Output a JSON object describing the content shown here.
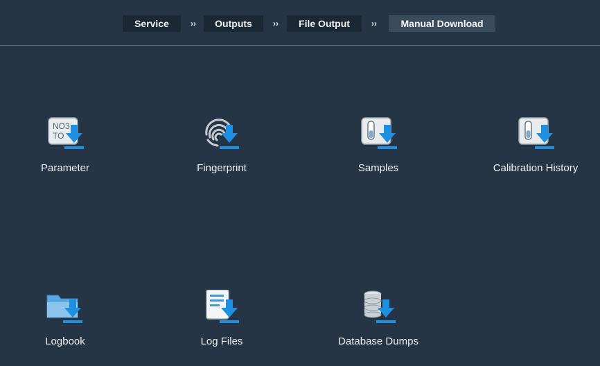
{
  "breadcrumb": {
    "items": [
      "Service",
      "Outputs",
      "File Output",
      "Manual Download"
    ],
    "separator": "››"
  },
  "tiles": [
    {
      "label": "Parameter",
      "icon": "parameter-download-icon",
      "icon_text_1": "NO3",
      "icon_text_2": "TO"
    },
    {
      "label": "Fingerprint",
      "icon": "fingerprint-download-icon"
    },
    {
      "label": "Samples",
      "icon": "samples-download-icon"
    },
    {
      "label": "Calibration History",
      "icon": "calibration-history-download-icon"
    },
    {
      "label": "Logbook",
      "icon": "logbook-download-icon"
    },
    {
      "label": "Log Files",
      "icon": "log-files-download-icon"
    },
    {
      "label": "Database Dumps",
      "icon": "database-dumps-download-icon"
    }
  ],
  "colors": {
    "background": "#253545",
    "accent": "#1f8fe0",
    "breadcrumb_bg": "#1a2734",
    "breadcrumb_active_bg": "#3a4b5c"
  }
}
